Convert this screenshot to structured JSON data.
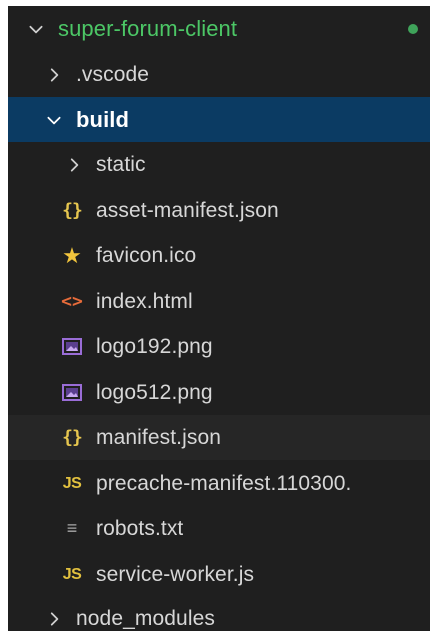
{
  "explorer": {
    "root": {
      "label": "super-forum-client",
      "expanded": true,
      "modified_indicator": true
    },
    "items": [
      {
        "label": ".vscode",
        "type": "folder",
        "expanded": false
      },
      {
        "label": "build",
        "type": "folder",
        "expanded": true,
        "selected": true
      },
      {
        "label": "static",
        "type": "folder",
        "expanded": false
      },
      {
        "label": "asset-manifest.json",
        "type": "json",
        "icon": "json-icon"
      },
      {
        "label": "favicon.ico",
        "type": "ico",
        "icon": "star-icon"
      },
      {
        "label": "index.html",
        "type": "html",
        "icon": "html-icon"
      },
      {
        "label": "logo192.png",
        "type": "image",
        "icon": "image-icon"
      },
      {
        "label": "logo512.png",
        "type": "image",
        "icon": "image-icon"
      },
      {
        "label": "manifest.json",
        "type": "json",
        "icon": "json-icon",
        "hover": true
      },
      {
        "label": "precache-manifest.110300.",
        "type": "js",
        "icon": "js-icon"
      },
      {
        "label": "robots.txt",
        "type": "text",
        "icon": "text-lines-icon"
      },
      {
        "label": "service-worker.js",
        "type": "js",
        "icon": "js-icon"
      },
      {
        "label": "node_modules",
        "type": "folder",
        "expanded": false
      }
    ],
    "icon_glyphs": {
      "json": "{}",
      "html": "<>",
      "js": "JS",
      "star": "★",
      "text": "≡"
    },
    "colors": {
      "background": "#1f1f1f",
      "selected_row": "#0b3b63",
      "root_label": "#4cc766",
      "json_icon": "#e6c64f",
      "html_icon": "#e66b3a",
      "js_icon": "#e2c13f",
      "image_icon": "#9a6dd7"
    }
  }
}
